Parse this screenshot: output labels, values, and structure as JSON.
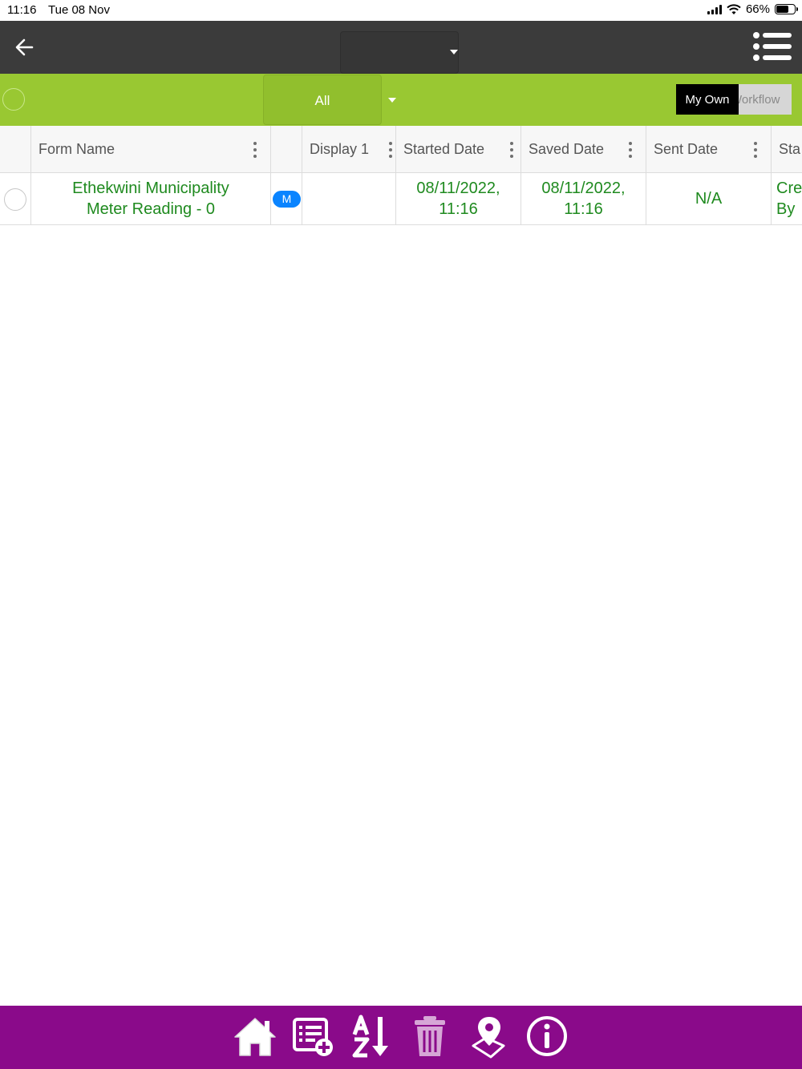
{
  "status_bar": {
    "time": "11:16",
    "date": "Tue 08 Nov",
    "battery": "66%",
    "battery_level": 0.66
  },
  "top_bar": {
    "background": "#3b3b3b",
    "title_value": ""
  },
  "filter_bar": {
    "background": "#99c832",
    "filter_value": "All",
    "toggle": {
      "on_label": "My Own",
      "off_label": "Workflow"
    }
  },
  "table": {
    "columns": [
      "Form Name",
      "Display 1",
      "Started Date",
      "Saved Date",
      "Sent Date",
      "Sta"
    ],
    "rows": [
      {
        "form_name_line1": "Ethekwini Municipality",
        "form_name_line2": "Meter Reading - 0",
        "badge": "M",
        "display1": "",
        "started_line1": "08/11/2022,",
        "started_line2": "11:16",
        "saved_line1": "08/11/2022,",
        "saved_line2": "11:16",
        "sent": "N/A",
        "status_line1": "Cre",
        "status_line2": "By"
      }
    ]
  },
  "bottom_bar": {
    "background": "#8a0a8a",
    "icons": [
      "home-icon",
      "new-form-icon",
      "sort-az-icon",
      "trash-icon",
      "map-pin-icon",
      "info-icon"
    ]
  }
}
